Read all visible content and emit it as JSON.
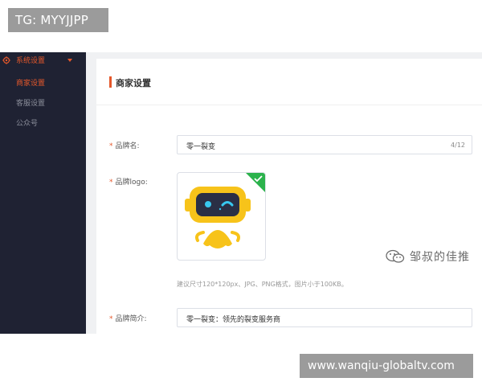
{
  "watermark_top": "TG: MYYJJPP",
  "watermark_bottom": "www.wanqiu-globaltv.com",
  "sidebar": {
    "group_label": "系统设置",
    "items": [
      {
        "label": "商家设置",
        "active": true
      },
      {
        "label": "客服设置",
        "active": false
      },
      {
        "label": "公众号",
        "active": false
      }
    ]
  },
  "page": {
    "title": "商家设置",
    "brand_name": {
      "label": "品牌名:",
      "value": "零一裂变",
      "count": "4/12"
    },
    "brand_logo": {
      "label": "品牌logo:",
      "hint": "建议尺寸120*120px、JPG、PNG格式，图片小于100KB。"
    },
    "brand_intro": {
      "label": "品牌简介:",
      "value": "零一裂变：领先的裂变服务商"
    }
  },
  "overlay": {
    "wechat_name": "邹叔的佳推"
  },
  "colors": {
    "accent": "#e5582b",
    "sidebar_bg": "#1f2233",
    "robot_yellow": "#f7c31a",
    "check_green": "#2bb24c"
  }
}
